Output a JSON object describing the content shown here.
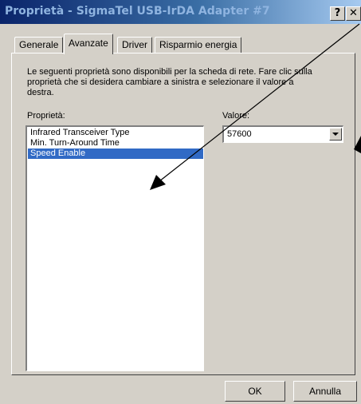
{
  "window": {
    "title": "Proprietà - SigmaTel USB-IrDA Adapter #7",
    "help_glyph": "?",
    "close_glyph": "✕"
  },
  "tabs": [
    {
      "label": "Generale",
      "active": false
    },
    {
      "label": "Avanzate",
      "active": true
    },
    {
      "label": "Driver",
      "active": false
    },
    {
      "label": "Risparmio energia",
      "active": false
    }
  ],
  "advanced": {
    "description": "Le seguenti proprietà sono disponibili per la scheda di rete. Fare clic sulla proprietà che si desidera cambiare a sinistra e selezionare il valore a destra.",
    "property_label": "Proprietà:",
    "value_label": "Valore:",
    "properties": [
      "Infrared Transceiver Type",
      "Min. Turn-Around Time",
      "Speed Enable"
    ],
    "selected_property": "Speed Enable",
    "value": "57600"
  },
  "buttons": {
    "ok": "OK",
    "cancel": "Annulla"
  },
  "colors": {
    "dialog_bg": "#d4d0c8",
    "selection": "#316ac5",
    "title_gradient_start": "#0a246a"
  }
}
